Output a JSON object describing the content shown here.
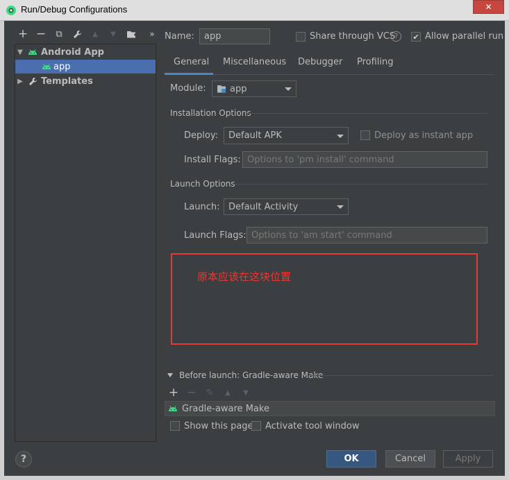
{
  "window": {
    "title": "Run/Debug Configurations",
    "close_glyph": "✕"
  },
  "left_toolbar": {
    "icons": [
      "add-icon",
      "remove-icon",
      "copy-icon",
      "wrench-icon",
      "move-up-icon",
      "move-down-icon",
      "new-folder-icon",
      "more-icon"
    ],
    "glyphs": {
      "add": "+",
      "remove": "−",
      "copy": "⧉",
      "wrench": "🔧",
      "up": "▲",
      "down": "▼",
      "folder": "📁",
      "more": "»"
    }
  },
  "tree": {
    "items": [
      {
        "label": "Android App",
        "expanded": true,
        "icon": "android-icon"
      },
      {
        "label": "app",
        "selected": true,
        "icon": "android-icon"
      },
      {
        "label": "Templates",
        "expanded": false,
        "icon": "wrench-icon"
      }
    ]
  },
  "name_row": {
    "name_label": "Name:",
    "name_value": "app",
    "share_label": "Share through VCS",
    "share_checked": false,
    "help_glyph": "?",
    "parallel_label": "Allow parallel run",
    "parallel_checked": true
  },
  "tabs": [
    "General",
    "Miscellaneous",
    "Debugger",
    "Profiling"
  ],
  "active_tab": "General",
  "general": {
    "module_label": "Module:",
    "module_value": "app",
    "installation_title": "Installation Options",
    "deploy_label": "Deploy:",
    "deploy_value": "Default APK",
    "instant_label": "Deploy as instant app",
    "install_flags_label": "Install Flags:",
    "install_flags_placeholder": "Options to 'pm install' command",
    "launch_title": "Launch Options",
    "launch_label": "Launch:",
    "launch_value": "Default Activity",
    "launch_flags_label": "Launch Flags:",
    "launch_flags_placeholder": "Options to 'am start' command"
  },
  "annotation": {
    "text": "原本应该在这块位置",
    "color": "#e53935"
  },
  "before_launch": {
    "title": "Before launch: Gradle-aware Make",
    "toolbar": {
      "add": "+",
      "remove": "−",
      "edit": "✎",
      "up": "▲",
      "down": "▼"
    },
    "items": [
      "Gradle-aware Make"
    ],
    "show_page_label": "Show this page",
    "activate_label": "Activate tool window"
  },
  "buttons": {
    "ok": "OK",
    "cancel": "Cancel",
    "apply": "Apply",
    "help": "?"
  },
  "colors": {
    "accent": "#4a88c7",
    "selection": "#4b6eaf",
    "android_green": "#3ddc84",
    "background": "#3c3f41"
  }
}
